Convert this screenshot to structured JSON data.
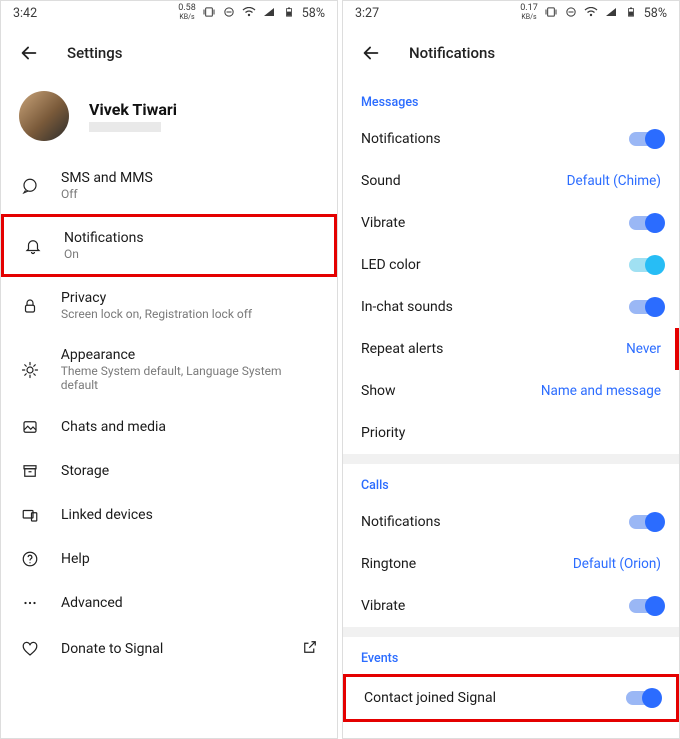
{
  "left": {
    "status": {
      "time": "3:42",
      "kbs": "0.58",
      "kbs_sub": "KB/s",
      "battery": "58%"
    },
    "title": "Settings",
    "profile": {
      "name": "Vivek Tiwari"
    },
    "items": {
      "sms": {
        "label": "SMS and MMS",
        "sub": "Off"
      },
      "notifications": {
        "label": "Notifications",
        "sub": "On"
      },
      "privacy": {
        "label": "Privacy",
        "sub": "Screen lock on, Registration lock off"
      },
      "appearance": {
        "label": "Appearance",
        "sub": "Theme System default, Language System default"
      },
      "chats": {
        "label": "Chats and media"
      },
      "storage": {
        "label": "Storage"
      },
      "linked": {
        "label": "Linked devices"
      },
      "help": {
        "label": "Help"
      },
      "advanced": {
        "label": "Advanced"
      },
      "donate": {
        "label": "Donate to Signal"
      }
    }
  },
  "right": {
    "status": {
      "time": "3:27",
      "kbs": "0.17",
      "kbs_sub": "KB/s",
      "battery": "58%"
    },
    "title": "Notifications",
    "sections": {
      "messages": {
        "header": "Messages",
        "notifications": "Notifications",
        "sound": "Sound",
        "sound_value": "Default (Chime)",
        "vibrate": "Vibrate",
        "led": "LED color",
        "inchat": "In-chat sounds",
        "repeat": "Repeat alerts",
        "repeat_value": "Never",
        "show": "Show",
        "show_value": "Name and message",
        "priority": "Priority"
      },
      "calls": {
        "header": "Calls",
        "notifications": "Notifications",
        "ringtone": "Ringtone",
        "ringtone_value": "Default (Orion)",
        "vibrate": "Vibrate"
      },
      "events": {
        "header": "Events",
        "contact": "Contact joined Signal"
      }
    }
  }
}
